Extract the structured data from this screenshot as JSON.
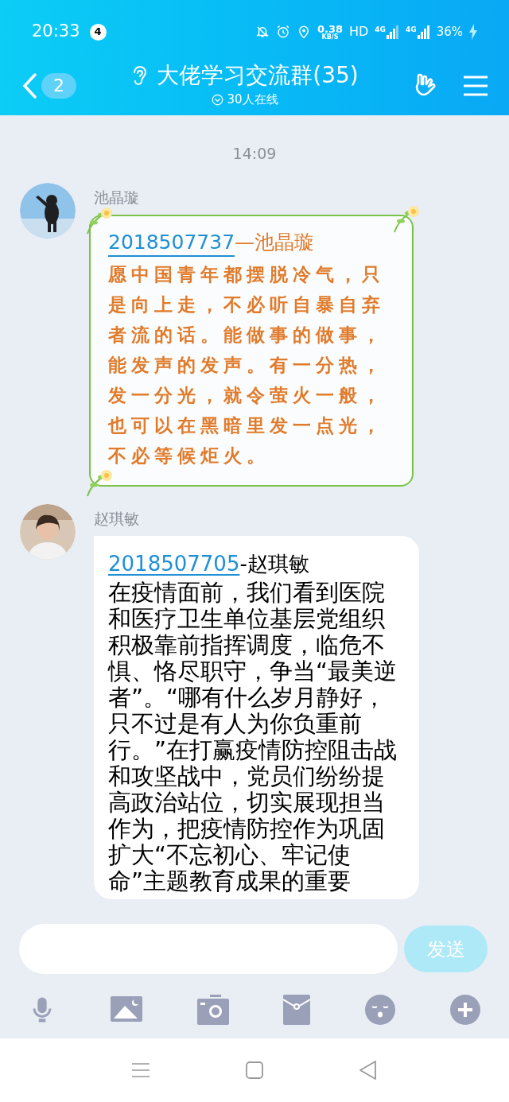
{
  "status_bar": {
    "time": "20:33",
    "notification_count": "4",
    "speed_value": "0.38",
    "speed_unit": "KB/S",
    "hd_label": "HD",
    "networks": [
      "4G",
      "4G"
    ],
    "battery": "36%"
  },
  "header": {
    "back_count": "2",
    "title": "大佬学习交流群(35)",
    "online": "30人在线"
  },
  "chat": {
    "timestamp": "14:09",
    "messages": [
      {
        "kind": "decorated",
        "sender": "池晶璇",
        "qq_id": "2018507737",
        "name_suffix": "—池晶璇",
        "text": "愿中国青年都摆脱冷气，只是向上走，不必听自暴自弃者流的话。能做事的做事，能发声的发声。有一分热，发一分光，就令萤火一般，也可以在黑暗里发一点光，不必等候炬火。"
      },
      {
        "kind": "plain",
        "sender": "赵琪敏",
        "qq_id": "2018507705",
        "name_suffix": "-赵琪敏",
        "text": "在疫情面前，我们看到医院和医疗卫生单位基层党组织积极靠前指挥调度，临危不惧、恪尽职守，争当“最美逆者”。“哪有什么岁月静好，只不过是有人为你负重前行。”在打赢疫情防控阻击战和攻坚战中，党员们纷纷提高政治站位，切实展现担当作为，把疫情防控作为巩固扩大“不忘初心、牢记使命”主题教育成果的重要"
      }
    ]
  },
  "composer": {
    "send_label": "发送",
    "send_disabled": true
  }
}
